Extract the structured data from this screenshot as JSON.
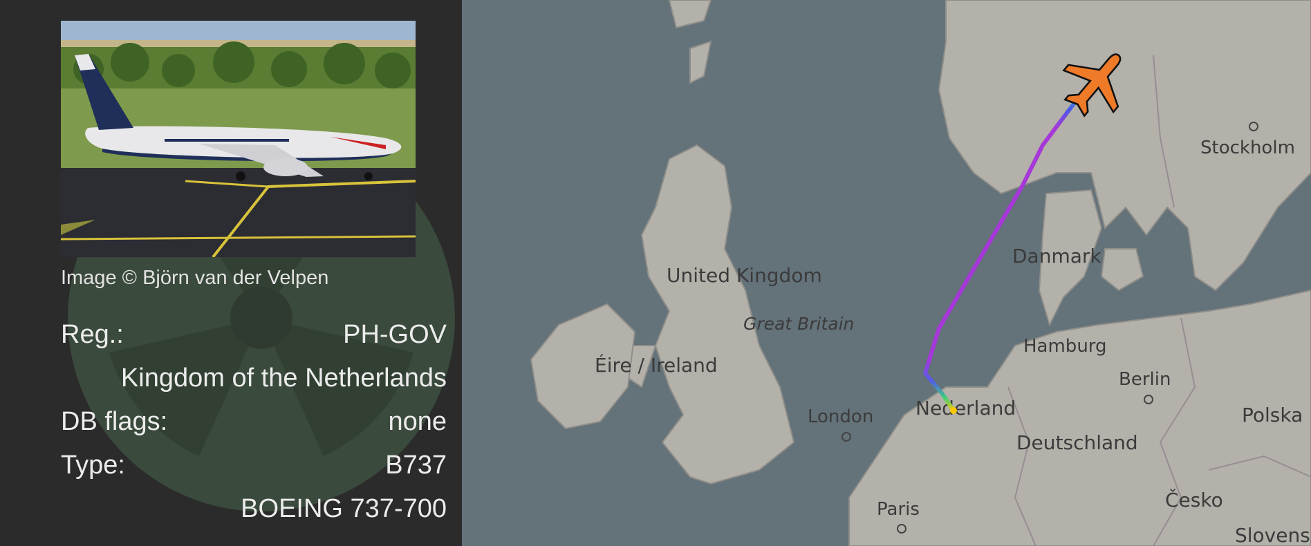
{
  "photo": {
    "credit": "Image © Björn van der Velpen",
    "alt": "Aircraft photo"
  },
  "details": {
    "reg_label": "Reg.:",
    "reg_value": "PH-GOV",
    "owner": "Kingdom of the Netherlands",
    "dbflags_label": "DB flags:",
    "dbflags_value": "none",
    "type_label": "Type:",
    "type_value": "B737",
    "model": "BOEING 737-700"
  },
  "map": {
    "labels": {
      "united_kingdom": "United Kingdom",
      "great_britain": "Great Britain",
      "ireland": "Éire / Ireland",
      "london": "London",
      "paris": "Paris",
      "nederland": "Nederland",
      "hamburg": "Hamburg",
      "berlin": "Berlin",
      "deutschland": "Deutschland",
      "danmark": "Danmark",
      "stockholm": "Stockholm",
      "polska": "Polska",
      "cesko": "Česko",
      "slovensko": "Slovens"
    },
    "colors": {
      "sea": "#64727a",
      "land": "#b3b1aa",
      "aircraft": "#ef7a28",
      "track": "#a637d8"
    },
    "aircraft_icon": "airplane-icon"
  }
}
